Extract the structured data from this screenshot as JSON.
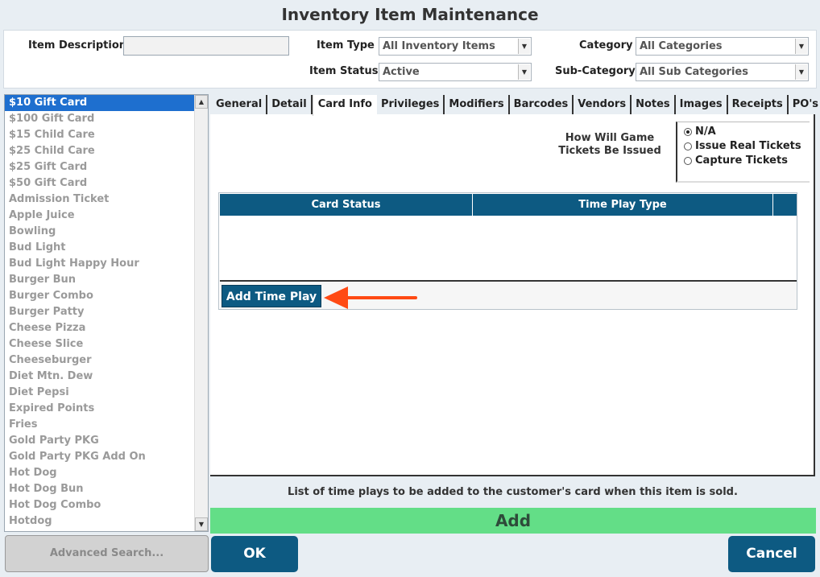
{
  "window": {
    "title": "Inventory Item Maintenance"
  },
  "filters": {
    "item_description_label": "Item Description",
    "item_description_value": "",
    "item_type_label": "Item Type",
    "item_type_value": "All Inventory Items",
    "item_status_label": "Item Status",
    "item_status_value": "Active",
    "category_label": "Category",
    "category_value": "All Categories",
    "subcategory_label": "Sub-Category",
    "subcategory_value": "All Sub Categories"
  },
  "item_list": {
    "selected_index": 0,
    "items": [
      "$10 Gift Card",
      "$100 Gift Card",
      "$15 Child Care",
      "$25 Child Care",
      "$25 Gift Card",
      "$50 Gift Card",
      "Admission Ticket",
      "Apple Juice",
      "Bowling",
      "Bud Light",
      "Bud Light Happy Hour",
      "Burger Bun",
      "Burger Combo",
      "Burger Patty",
      "Cheese Pizza",
      "Cheese Slice",
      "Cheeseburger",
      "Diet Mtn. Dew",
      "Diet Pepsi",
      "Expired Points",
      "Fries",
      "Gold Party PKG",
      "Gold Party PKG Add On",
      "Hot Dog",
      "Hot Dog Bun",
      "Hot Dog Combo",
      "Hotdog"
    ]
  },
  "advanced_search_label": "Advanced Search...",
  "tabs": [
    {
      "label": "General",
      "active": false
    },
    {
      "label": "Detail",
      "active": false
    },
    {
      "label": "Card Info",
      "active": true
    },
    {
      "label": "Privileges",
      "active": false
    },
    {
      "label": "Modifiers",
      "active": false
    },
    {
      "label": "Barcodes",
      "active": false
    },
    {
      "label": "Vendors",
      "active": false
    },
    {
      "label": "Notes",
      "active": false
    },
    {
      "label": "Images",
      "active": false
    },
    {
      "label": "Receipts",
      "active": false
    },
    {
      "label": "PO's",
      "active": false
    }
  ],
  "card_info": {
    "game_tickets_label_line1": "How Will Game",
    "game_tickets_label_line2": "Tickets Be Issued",
    "radio_options": [
      {
        "label": "N/A",
        "checked": true
      },
      {
        "label": "Issue Real Tickets",
        "checked": false
      },
      {
        "label": "Capture Tickets",
        "checked": false
      }
    ],
    "grid_columns": [
      "Card Status",
      "Time Play Type"
    ],
    "add_time_play_label": "Add Time Play"
  },
  "hint_text": "List of time plays to be added to the customer's card when this item is sold.",
  "add_label": "Add",
  "ok_label": "OK",
  "cancel_label": "Cancel",
  "colors": {
    "primary": "#0d5a82",
    "selection": "#1e6fcf",
    "add_bar": "#63de87",
    "annotation_arrow": "#ff4a14"
  }
}
